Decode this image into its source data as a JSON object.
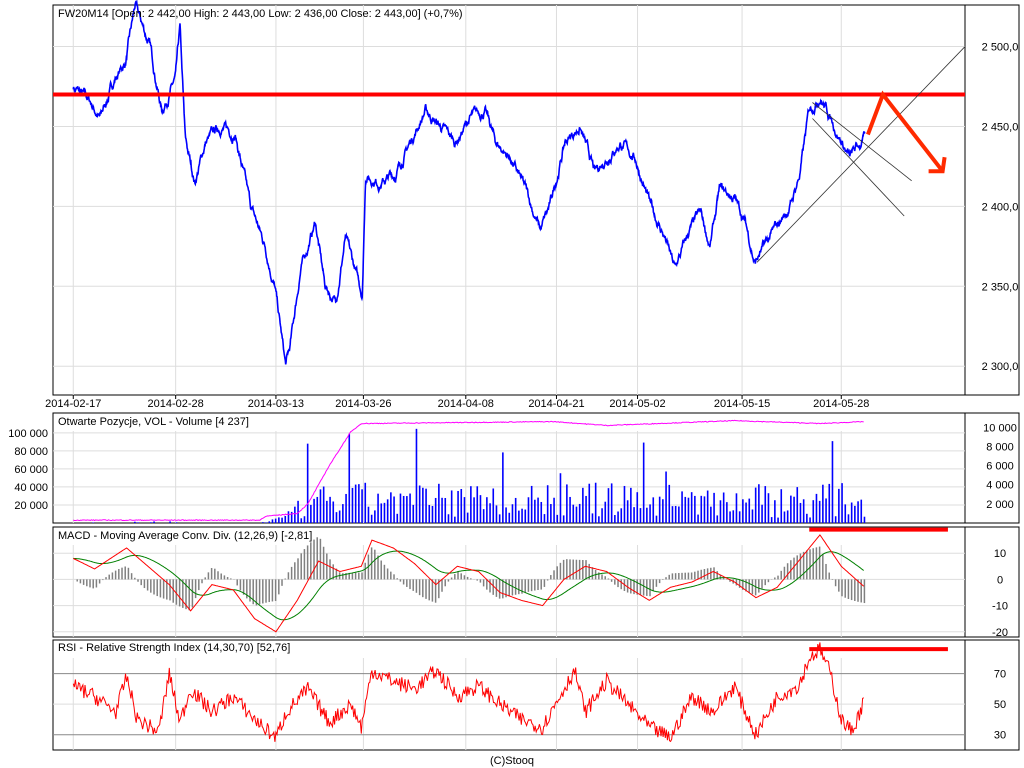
{
  "chart_data": [
    {
      "type": "line",
      "title": "FW20M14 [Open: 2 442,00  High: 2 443,00  Low: 2 436,00  Close: 2 443,00] (+0,7%)",
      "x_unit": "trading day index from 2014-02-17",
      "xlim": [
        -1.9,
        83.6
      ],
      "ylim": [
        2282,
        2526
      ],
      "x_ticks": [
        {
          "x": 0,
          "label": "2014-02-17"
        },
        {
          "x": 9.6,
          "label": "2014-02-28"
        },
        {
          "x": 19,
          "label": "2014-03-13"
        },
        {
          "x": 27.2,
          "label": "2014-03-26"
        },
        {
          "x": 36.8,
          "label": "2014-04-08"
        },
        {
          "x": 45.3,
          "label": "2014-04-21"
        },
        {
          "x": 52.9,
          "label": "2014-05-02"
        },
        {
          "x": 62.7,
          "label": "2014-05-15"
        },
        {
          "x": 72,
          "label": "2014-05-28"
        }
      ],
      "y_ticks": [
        {
          "y": 2300,
          "label": "2 300,0"
        },
        {
          "y": 2350,
          "label": "2 350,0"
        },
        {
          "y": 2400,
          "label": "2 400,0"
        },
        {
          "y": 2450,
          "label": "2 450,0"
        },
        {
          "y": 2500,
          "label": "2 500,0"
        }
      ],
      "series": [
        {
          "name": "FW20M14",
          "color": "#0000ff",
          "x": [
            0,
            1.6,
            2.5,
            3.9,
            4.9,
            5.8,
            7.2,
            8.3,
            9.6,
            10,
            10.5,
            11.4,
            12.4,
            13.8,
            15.2,
            16.6,
            18,
            18.9,
            19.9,
            20.3,
            21.3,
            22.7,
            23.6,
            24.6,
            25.5,
            26.4,
            27.1,
            27.4,
            28.8,
            30.2,
            31.6,
            33,
            34.4,
            35.8,
            37.2,
            38.6,
            39.6,
            41,
            42.4,
            43.8,
            44.7,
            46.1,
            47.5,
            48.9,
            49.9,
            51.3,
            52.7,
            54.1,
            55.5,
            56.4,
            57.8,
            58.8,
            59.7,
            60.6,
            62,
            63,
            63.9,
            65.3,
            67.2,
            68.1,
            69,
            70,
            71.4,
            72.8,
            74.2
          ],
          "y": [
            2475,
            2465,
            2455,
            2480,
            2490,
            2525,
            2500,
            2460,
            2480,
            2510,
            2440,
            2415,
            2440,
            2450,
            2445,
            2400,
            2375,
            2350,
            2300,
            2310,
            2360,
            2390,
            2350,
            2340,
            2380,
            2360,
            2345,
            2420,
            2415,
            2420,
            2440,
            2460,
            2450,
            2440,
            2455,
            2460,
            2440,
            2430,
            2410,
            2385,
            2400,
            2440,
            2450,
            2420,
            2430,
            2440,
            2430,
            2400,
            2380,
            2360,
            2385,
            2395,
            2375,
            2410,
            2405,
            2390,
            2365,
            2380,
            2400,
            2420,
            2460,
            2470,
            2450,
            2430,
            2443
          ]
        }
      ],
      "annotations": {
        "resistance": {
          "price": 2470,
          "color": "#ff0000"
        },
        "trendline_up": [
          [
            64.1,
            2365
          ],
          [
            83.6,
            2500
          ]
        ],
        "channel_1": [
          [
            69.3,
            2465
          ],
          [
            78.6,
            2416
          ]
        ],
        "channel_2": [
          [
            69.3,
            2455
          ],
          [
            77.9,
            2394
          ]
        ],
        "arrow": [
          [
            74.5,
            2445
          ],
          [
            75.9,
            2470
          ],
          [
            81.5,
            2422
          ]
        ]
      }
    },
    {
      "type": "bar",
      "title": "Otwarte Pozycje, VOL - Volume [4 237]",
      "left_ylim": [
        0,
        122000
      ],
      "right_ylim": [
        0,
        11500
      ],
      "left_ticks": [
        {
          "y": 20000,
          "label": "20 000"
        },
        {
          "y": 40000,
          "label": "40 000"
        },
        {
          "y": 60000,
          "label": "60 000"
        },
        {
          "y": 80000,
          "label": "80 000"
        },
        {
          "y": 100000,
          "label": "100 000"
        }
      ],
      "right_ticks": [
        {
          "y": 2000,
          "label": "2 000"
        },
        {
          "y": 4000,
          "label": "4 000"
        },
        {
          "y": 6000,
          "label": "6 000"
        },
        {
          "y": 8000,
          "label": "8 000"
        },
        {
          "y": 10000,
          "label": "10 000"
        }
      ],
      "volume_level": {
        "color": "#0000ff",
        "x": [
          0,
          18,
          20,
          22,
          24,
          27,
          74.2
        ],
        "y": [
          1500,
          1500,
          8000,
          25000,
          30000,
          30000,
          30000
        ]
      },
      "open_interest": {
        "color": "#ff00ff",
        "x": [
          0,
          17.5,
          18,
          21,
          22,
          24,
          26,
          27,
          36,
          45,
          50,
          62,
          70,
          74.2
        ],
        "y": [
          300,
          300,
          700,
          1000,
          2000,
          6000,
          9500,
          10400,
          10500,
          10600,
          10200,
          10700,
          10400,
          10600
        ]
      }
    },
    {
      "type": "line",
      "title": "MACD - Moving Average Conv. Div. (12,26,9) [-2,81]",
      "ylim": [
        -22,
        20
      ],
      "y_ticks": [
        {
          "y": -20,
          "label": "-20"
        },
        {
          "y": -10,
          "label": "-10"
        },
        {
          "y": 0,
          "label": "0"
        },
        {
          "y": 10,
          "label": "10"
        }
      ],
      "macd": {
        "color": "#ff0000",
        "x": [
          0,
          2,
          5,
          7,
          9,
          11,
          13,
          15,
          17,
          19,
          21,
          23,
          25,
          27,
          28,
          30,
          32,
          34,
          36,
          38,
          40,
          42,
          44,
          46,
          48,
          50,
          52,
          54,
          56,
          58,
          60,
          62,
          64,
          66,
          69,
          70,
          72,
          74.2
        ],
        "y": [
          8,
          4,
          12,
          5,
          -2,
          -12,
          -2,
          -4,
          -15,
          -20,
          -8,
          7,
          3,
          5,
          15,
          12,
          6,
          -2,
          5,
          3,
          -5,
          -8,
          -10,
          0,
          5,
          3,
          -3,
          -8,
          -3,
          -1,
          3,
          -1,
          -7,
          -3,
          12,
          17,
          5,
          -3
        ]
      },
      "signal_color": "#008000",
      "histogram_color": "#808080",
      "annotation": {
        "level": 19,
        "from": 69,
        "to": 82,
        "color": "#ff0000"
      }
    },
    {
      "type": "line",
      "title": "RSI - Relative Strength Index (14,30,70) [52,76]",
      "ylim": [
        20,
        92
      ],
      "y_ticks": [
        {
          "y": 30,
          "label": "30"
        },
        {
          "y": 50,
          "label": "50"
        },
        {
          "y": 70,
          "label": "70"
        }
      ],
      "rsi": {
        "color": "#ff0000",
        "x": [
          0,
          2,
          4,
          5,
          6,
          8,
          9,
          10,
          11,
          13,
          15,
          17,
          19,
          20,
          22,
          24,
          26,
          27,
          28,
          30,
          32,
          34,
          36,
          38,
          40,
          42,
          44,
          46,
          47,
          48,
          50,
          52,
          54,
          56,
          58,
          60,
          62,
          63,
          64,
          66,
          68,
          69,
          70,
          71,
          72,
          73,
          74.2
        ],
        "y": [
          62,
          55,
          45,
          68,
          40,
          32,
          70,
          38,
          60,
          45,
          55,
          40,
          28,
          45,
          60,
          38,
          50,
          35,
          72,
          65,
          60,
          72,
          55,
          62,
          50,
          40,
          35,
          60,
          72,
          45,
          65,
          50,
          35,
          28,
          55,
          45,
          62,
          45,
          30,
          55,
          62,
          80,
          86,
          70,
          40,
          32,
          53
        ]
      },
      "annotation": {
        "level": 86,
        "from": 69,
        "to": 82,
        "color": "#ff0000"
      }
    }
  ],
  "footer": "(C)Stooq"
}
